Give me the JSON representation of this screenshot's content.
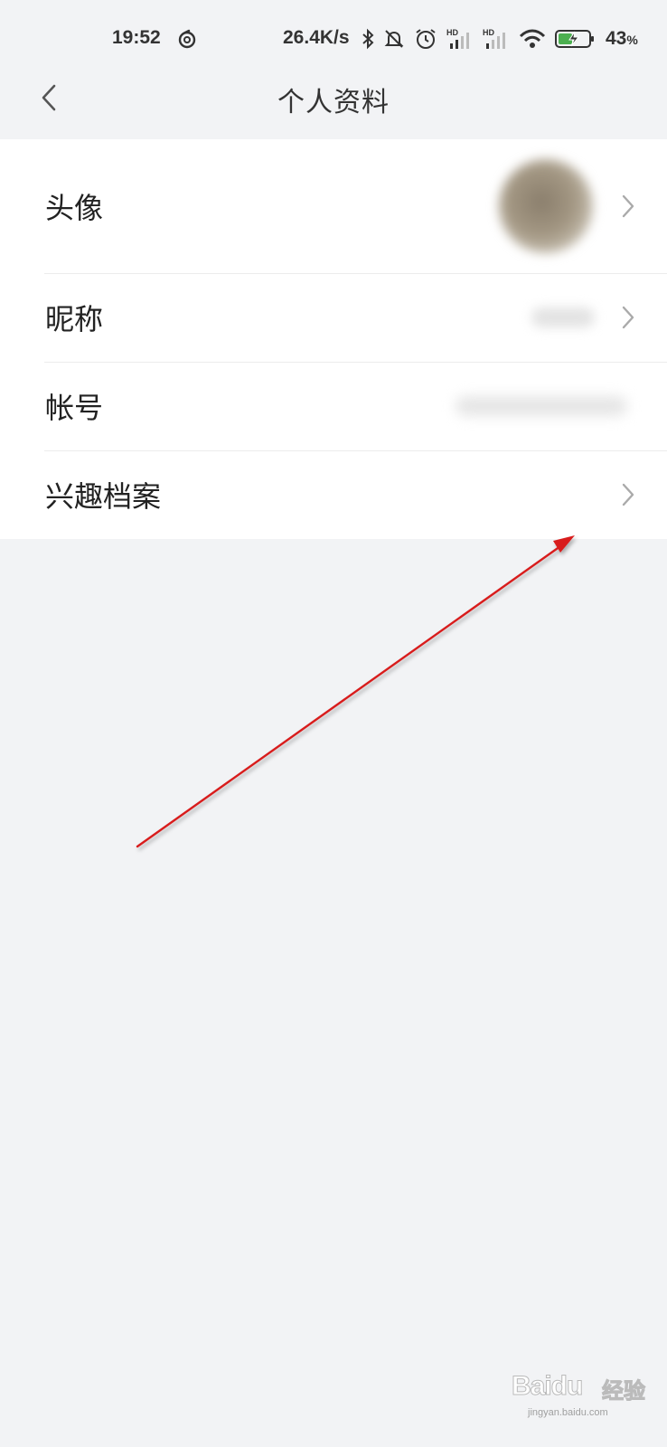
{
  "status_bar": {
    "time": "19:52",
    "net_speed": "26.4K/s",
    "signal_label_1": "HD",
    "signal_label_2": "HD",
    "battery_percent": "43",
    "battery_unit": "%",
    "battery_color": "#4caf50"
  },
  "nav": {
    "title": "个人资料",
    "back_icon": "chevron-left-icon"
  },
  "profile": {
    "rows": [
      {
        "label": "头像",
        "value_type": "avatar-image-blurred",
        "has_chevron": true
      },
      {
        "label": "昵称",
        "value_type": "blurred-text",
        "has_chevron": true
      },
      {
        "label": "帐号",
        "value_type": "blurred-text",
        "has_chevron": false
      },
      {
        "label": "兴趣档案",
        "value_type": "none",
        "has_chevron": true
      }
    ]
  },
  "annotation": {
    "type": "arrow",
    "color": "#d81e1e",
    "points_to": "兴趣档案"
  },
  "watermark": {
    "brand": "Baidu",
    "suffix": "经验",
    "url": "jingyan.baidu.com"
  }
}
